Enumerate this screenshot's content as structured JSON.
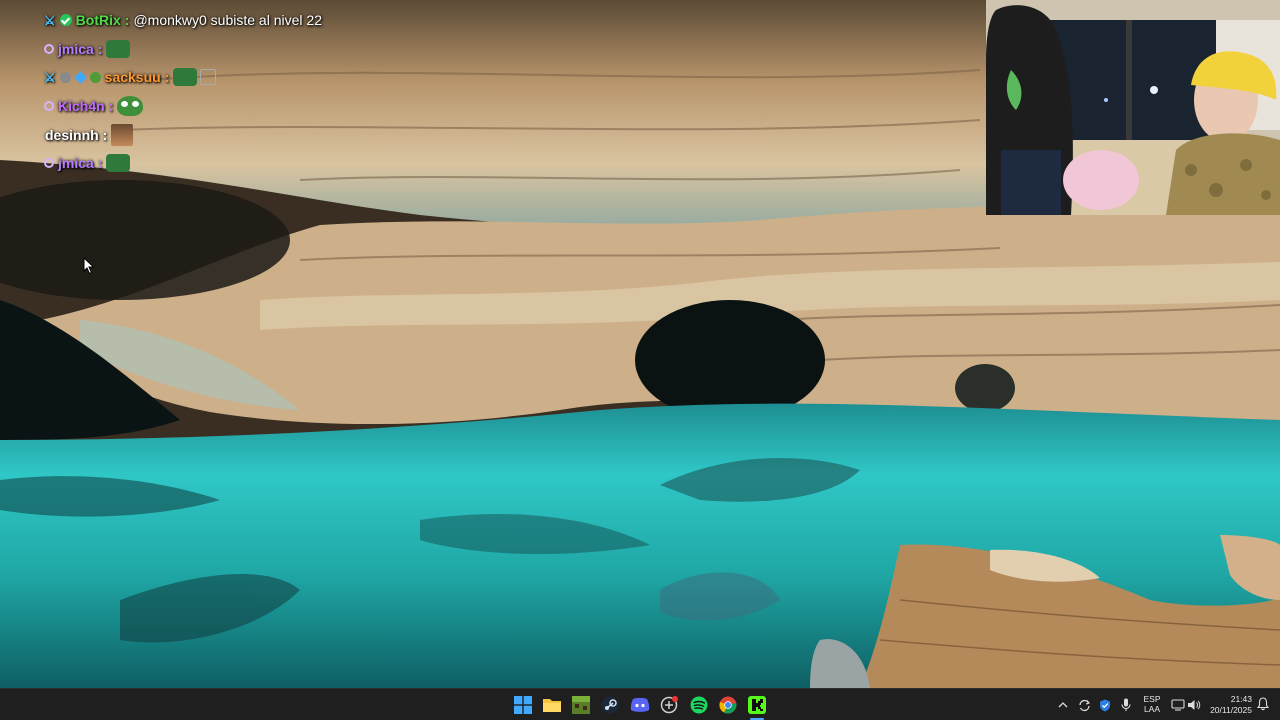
{
  "chat": {
    "messages": [
      {
        "user": "BotRix",
        "user_color": "#52d84a",
        "badges": [
          "moderator-sword-icon",
          "verified-check-icon"
        ],
        "text": "@monkwy0 subiste al nivel 22"
      },
      {
        "user": "jmica",
        "user_color": "#b57cff",
        "badges": [
          "subscriber-ring-icon"
        ],
        "emote": "green-emote"
      },
      {
        "user": "sacksuu",
        "user_color": "#ff9a2e",
        "badges": [
          "moderator-sword-icon",
          "grey-badge-icon",
          "blue-cube-badge-icon",
          "frog-badge-icon"
        ],
        "emote": "green-emote"
      },
      {
        "user": "Kich4n",
        "user_color": "#c06cff",
        "badges": [
          "subscriber-ring-icon"
        ],
        "emote": "pepe-emote"
      },
      {
        "user": "desinnh",
        "user_color": "#ffffff",
        "badges": [],
        "emote": "face-emote"
      },
      {
        "user": "jmica",
        "user_color": "#b57cff",
        "badges": [
          "subscriber-ring-icon"
        ],
        "emote": "green-emote"
      }
    ]
  },
  "taskbar": {
    "apps": [
      "windows-start-icon",
      "file-explorer-icon",
      "minecraft-launcher-icon",
      "steam-icon",
      "discord-icon",
      "game-app-icon",
      "spotify-icon",
      "chrome-icon",
      "kick-icon"
    ],
    "tray_icons": [
      "chevron-up-icon",
      "sync-icon",
      "security-shield-icon",
      "microphone-icon",
      "language-indicator",
      "network-icon",
      "speaker-icon"
    ],
    "language": {
      "line1": "ESP",
      "line2": "LAA"
    },
    "clock": {
      "time": "21:43",
      "date": "20/11/2025"
    }
  },
  "colors": {
    "taskbar": "#1f1f1f",
    "water": "#27c6c4",
    "rock": "#c9a27a",
    "botrix": "#52d84a",
    "jmica": "#b57cff"
  }
}
